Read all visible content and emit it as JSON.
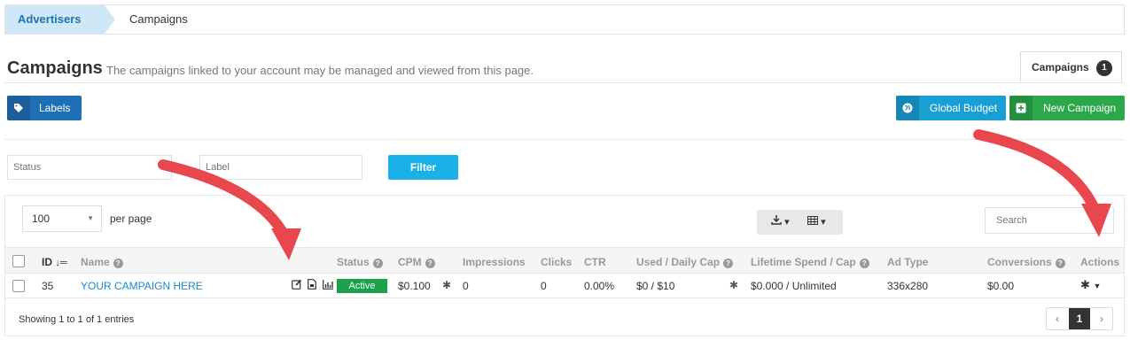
{
  "breadcrumb": {
    "items": [
      "Advertisers",
      "Campaigns"
    ]
  },
  "header": {
    "title": "Campaigns",
    "subtitle": "The campaigns linked to your account may be managed and viewed from this page.",
    "tab_label": "Campaigns",
    "tab_count": "1"
  },
  "toolbar": {
    "labels_btn": "Labels",
    "global_budget_btn": "Global Budget",
    "new_campaign_btn": "New Campaign"
  },
  "filters": {
    "status_placeholder": "Status",
    "label_placeholder": "Label",
    "filter_btn": "Filter"
  },
  "table": {
    "per_page_value": "100",
    "per_page_text": "per page",
    "search_placeholder": "Search",
    "columns": [
      "ID",
      "Name",
      "Status",
      "CPM",
      "Impressions",
      "Clicks",
      "CTR",
      "Used / Daily Cap",
      "Lifetime Spend / Cap",
      "Ad Type",
      "Conversions",
      "Actions"
    ],
    "rows": [
      {
        "id": "35",
        "name": "YOUR CAMPAIGN HERE",
        "status": "Active",
        "cpm": "$0.100",
        "impressions": "0",
        "clicks": "0",
        "ctr": "0.00%",
        "used_daily_cap": "$0 / $10",
        "lifetime_spend_cap": "$0.000 / Unlimited",
        "ad_type": "336x280",
        "conversions": "$0.00"
      }
    ],
    "showing": "Showing 1 to 1 of 1 entries",
    "current_page": "1"
  },
  "colors": {
    "primary": "#1f6fb5",
    "info": "#1a9fd4",
    "success": "#2ba84a",
    "active_badge": "#1aa14a",
    "arrow": "#e8474d"
  }
}
